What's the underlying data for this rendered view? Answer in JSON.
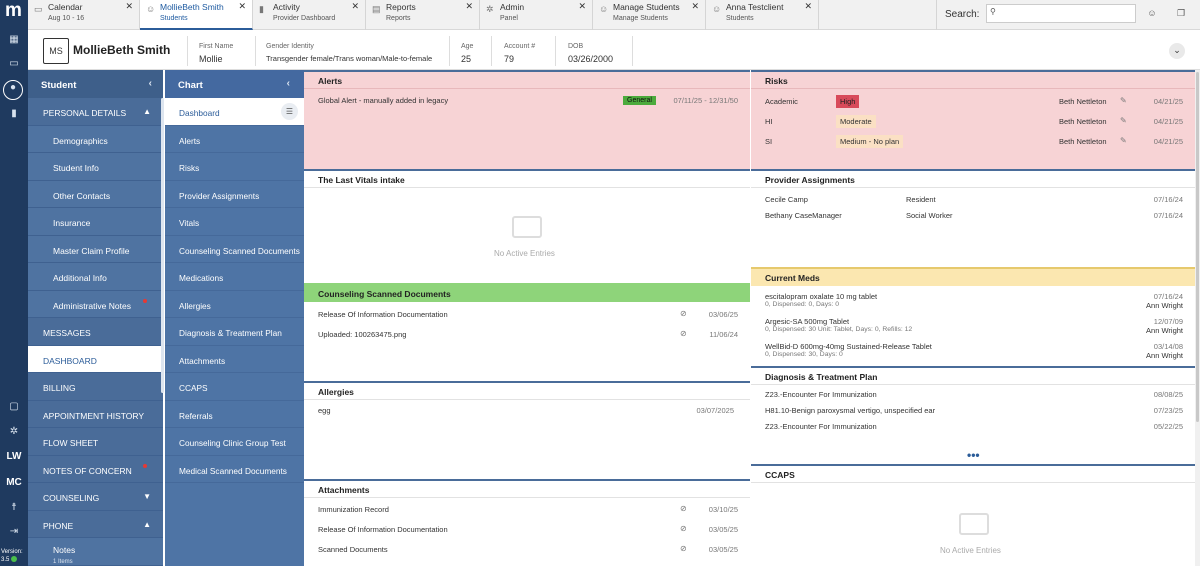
{
  "rail": {
    "logo": "m",
    "items": [
      "grid-icon",
      "calendar-icon",
      "user-icon",
      "chart-icon"
    ],
    "bottom_items": [
      "chat-icon",
      "settings-icon"
    ],
    "lw": "LW",
    "mc": "MC",
    "bottom_icons": [
      "accessibility-icon",
      "logout-icon"
    ],
    "version_label": "Version:",
    "version": "3.5"
  },
  "tabs": [
    {
      "title": "Calendar",
      "sub": "Aug 10 - 16",
      "icon": "calendar-icon"
    },
    {
      "title": "MollieBeth Smith",
      "sub": "Students",
      "icon": "user-icon"
    },
    {
      "title": "Activity",
      "sub": "Provider Dashboard",
      "icon": "chart-icon"
    },
    {
      "title": "Reports",
      "sub": "Reports",
      "icon": "report-icon"
    },
    {
      "title": "Admin",
      "sub": "Panel",
      "icon": "gear-icon"
    },
    {
      "title": "Manage Students",
      "sub": "Manage Students",
      "icon": "user-icon"
    },
    {
      "title": "Anna Testclient",
      "sub": "Students",
      "icon": "user-icon"
    }
  ],
  "search": {
    "label": "Search:",
    "placeholder": ""
  },
  "patient": {
    "initials": "MS",
    "name": "MollieBeth Smith",
    "first_name_label": "First Name",
    "first_name": "Mollie",
    "gender_label": "Gender Identity",
    "gender": "Transgender female/Trans woman/Male-to-female",
    "age_label": "Age",
    "age": "25",
    "account_label": "Account #",
    "account": "79",
    "dob_label": "DOB",
    "dob": "03/26/2000"
  },
  "student_nav": {
    "title": "Student",
    "items": [
      {
        "label": "PERSONAL DETAILS",
        "type": "section",
        "caret": "▲"
      },
      {
        "label": "Demographics",
        "type": "sub"
      },
      {
        "label": "Student Info",
        "type": "sub"
      },
      {
        "label": "Other Contacts",
        "type": "sub"
      },
      {
        "label": "Insurance",
        "type": "sub"
      },
      {
        "label": "Master Claim Profile",
        "type": "sub"
      },
      {
        "label": "Additional Info",
        "type": "sub"
      },
      {
        "label": "Administrative Notes",
        "type": "sub",
        "dot": true
      },
      {
        "label": "MESSAGES",
        "type": "section"
      },
      {
        "label": "DASHBOARD",
        "type": "section",
        "selected": true
      },
      {
        "label": "BILLING",
        "type": "section"
      },
      {
        "label": "APPOINTMENT HISTORY",
        "type": "section"
      },
      {
        "label": "FLOW SHEET",
        "type": "section"
      },
      {
        "label": "NOTES OF CONCERN",
        "type": "section",
        "dot": true
      },
      {
        "label": "COUNSELING",
        "type": "section",
        "caret": "▼"
      },
      {
        "label": "PHONE",
        "type": "section",
        "caret": "▲"
      },
      {
        "label": "Notes",
        "type": "sub",
        "sub2": "1 Items"
      }
    ]
  },
  "chart_nav": {
    "title": "Chart",
    "items": [
      {
        "label": "Dashboard",
        "selected": true
      },
      {
        "label": "Alerts"
      },
      {
        "label": "Risks"
      },
      {
        "label": "Provider Assignments"
      },
      {
        "label": "Vitals"
      },
      {
        "label": "Counseling Scanned Documents"
      },
      {
        "label": "Medications"
      },
      {
        "label": "Allergies"
      },
      {
        "label": "Diagnosis & Treatment Plan"
      },
      {
        "label": "Attachments"
      },
      {
        "label": "CCAPS"
      },
      {
        "label": "Referrals"
      },
      {
        "label": "Counseling Clinic Group Test"
      },
      {
        "label": "Medical Scanned Documents"
      }
    ]
  },
  "alerts": {
    "title": "Alerts",
    "rows": [
      {
        "text": "Global Alert - manually added in legacy",
        "badge": "General",
        "dates": "07/11/25 - 12/31/50"
      }
    ]
  },
  "risks": {
    "title": "Risks",
    "rows": [
      {
        "type": "Academic",
        "level": "High",
        "provider": "Beth Nettleton",
        "date": "04/21/25"
      },
      {
        "type": "HI",
        "level": "Moderate",
        "provider": "Beth Nettleton",
        "date": "04/21/25"
      },
      {
        "type": "SI",
        "level": "Medium - No plan",
        "provider": "Beth Nettleton",
        "date": "04/21/25"
      }
    ]
  },
  "vitals": {
    "title": "The Last Vitals intake",
    "empty": "No Active Entries"
  },
  "provider_assignments": {
    "title": "Provider Assignments",
    "rows": [
      {
        "name": "Cecile Camp",
        "role": "Resident",
        "date": "07/16/24"
      },
      {
        "name": "Bethany CaseManager",
        "role": "Social Worker",
        "date": "07/16/24"
      }
    ]
  },
  "counseling_docs": {
    "title": "Counseling Scanned Documents",
    "rows": [
      {
        "name": "Release Of Information Documentation",
        "date": "03/06/25"
      },
      {
        "name": "Uploaded: 100263475.png",
        "date": "11/06/24"
      }
    ]
  },
  "current_meds": {
    "title": "Current Meds",
    "rows": [
      {
        "name": "escitalopram oxalate 10 mg tablet",
        "detail": "0, Dispensed: 0, Days: 0",
        "date": "07/16/24",
        "provider": "Ann Wright"
      },
      {
        "name": "Argesic-SA 500mg Tablet",
        "detail": "0, Dispensed: 30 Unit: Tablet, Days: 0, Refills: 12",
        "date": "12/07/09",
        "provider": "Ann Wright"
      },
      {
        "name": "WellBid-D 600mg-40mg Sustained-Release Tablet",
        "detail": "0, Dispensed: 30, Days: 0",
        "date": "03/14/08",
        "provider": "Ann Wright"
      }
    ]
  },
  "allergies": {
    "title": "Allergies",
    "rows": [
      {
        "name": "egg",
        "date": "03/07/2025"
      }
    ]
  },
  "diagnosis": {
    "title": "Diagnosis & Treatment Plan",
    "rows": [
      {
        "name": "Z23.-Encounter For Immunization",
        "date": "08/08/25"
      },
      {
        "name": "H81.10-Benign paroxysmal vertigo, unspecified ear",
        "date": "07/23/25"
      },
      {
        "name": "Z23.-Encounter For Immunization",
        "date": "05/22/25"
      }
    ],
    "more": "•••"
  },
  "attachments": {
    "title": "Attachments",
    "rows": [
      {
        "name": "Immunization Record",
        "date": "03/10/25"
      },
      {
        "name": "Release Of Information Documentation",
        "date": "03/05/25"
      },
      {
        "name": "Scanned Documents",
        "date": "03/05/25"
      }
    ]
  },
  "ccaps": {
    "title": "CCAPS",
    "empty": "No Active Entries"
  },
  "colors": {
    "nav_dark": "#1f3a5f",
    "nav": "#4a6c99",
    "alert_bg": "#f7d3d5",
    "docs_header": "#8ed47a",
    "meds_header": "#fbe7b0",
    "high": "#d84a5a",
    "general": "#4caa3c"
  }
}
